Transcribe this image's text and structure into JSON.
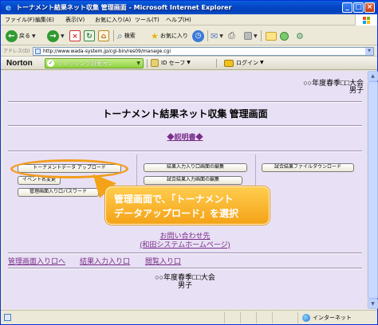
{
  "window": {
    "title": "トーナメント結果ネット収集 管理画面 - Microsoft Internet Explorer"
  },
  "menu": [
    "ファイル(F)",
    "編集(E)",
    "表示(V)",
    "お気に入り(A)",
    "ツール(T)",
    "ヘルプ(H)"
  ],
  "toolbar": {
    "back_label": "戻る",
    "search_label": "検索",
    "favorites_label": "お気に入り"
  },
  "address": {
    "label": "アドレス(D)",
    "url": "http://www.wada-system.jp/cgi-bin/res09/manage.cgi"
  },
  "norton": {
    "logo": "Norton",
    "phishing_label": "フィッシング対策オン",
    "idsafe_label": "ID セーフ",
    "login_label": "ログイン"
  },
  "page": {
    "event_name": "○○年度春季□□大会",
    "category": "男子",
    "title": "トーナメント結果ネット収集 管理画面",
    "manual_link": "◆説明書◆",
    "buttons": {
      "upload": "トーナメントデータ アップロード",
      "event_change": "イベント名変更",
      "password": "管理画面入り口パスワード",
      "entry_edit": "結果入力入り口画面の編集",
      "result_edit": "試合結果入力画面の編集",
      "download": "試合結果ファイルダウンロード"
    },
    "callout": {
      "line1": "管理画面で、「トーナメント",
      "line2": "データアップロード」を選択"
    },
    "contact_line1": "お問い合わせ先",
    "contact_line2": "(和田システムホームページ)",
    "nav": {
      "manage_entry": "管理画面入り口へ",
      "result_entry": "結果入力入り口",
      "browse_entry": "閲覧入り口"
    },
    "footer_event": "○○年度春季□□大会",
    "footer_category": "男子"
  },
  "status": {
    "zone": "インターネット"
  },
  "colors": {
    "page_bg": "#e8e0f4",
    "link": "#7a2e8a",
    "callout": "#f4a318",
    "titlebar": "#0648c8"
  }
}
